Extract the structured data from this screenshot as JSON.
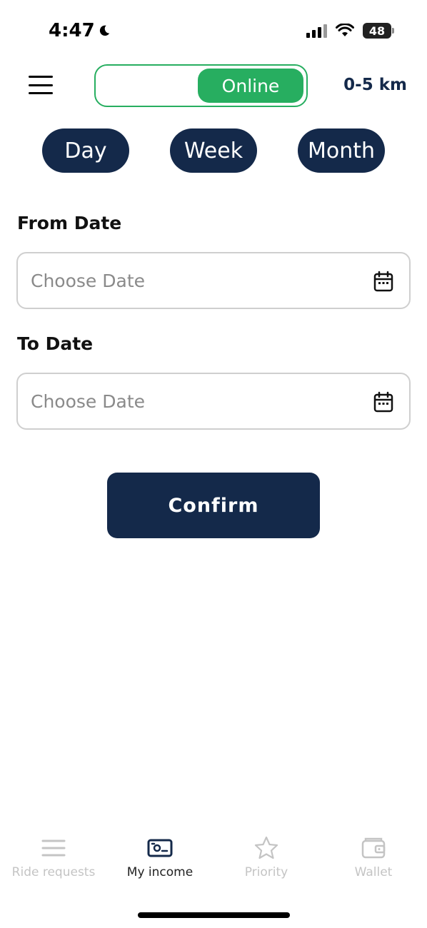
{
  "status_bar": {
    "time": "4:47",
    "battery": "48"
  },
  "header": {
    "online_label": "Online",
    "distance": "0-5 km"
  },
  "periods": {
    "day": "Day",
    "week": "Week",
    "month": "Month"
  },
  "form": {
    "from_label": "From Date",
    "from_placeholder": "Choose Date",
    "to_label": "To Date",
    "to_placeholder": "Choose Date",
    "confirm": "Confirm"
  },
  "nav": {
    "ride_requests": "Ride requests",
    "my_income": "My income",
    "priority": "Priority",
    "wallet": "Wallet",
    "active": "my_income"
  },
  "colors": {
    "primary": "#14294a",
    "online": "#27ae60",
    "inactive": "#c4c4c4"
  }
}
